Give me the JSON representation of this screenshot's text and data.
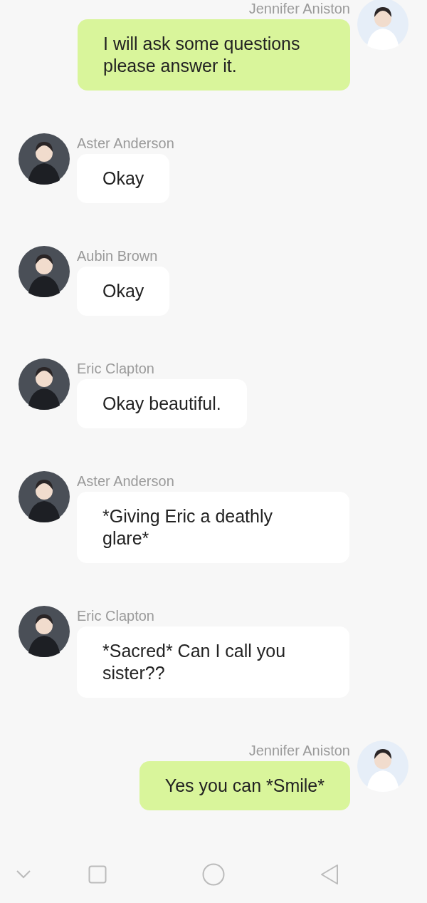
{
  "messages": [
    {
      "sender": "Jennifer Aniston",
      "kind": "sent",
      "text": "I will ask some questions please answer it."
    },
    {
      "sender": "Aster Anderson",
      "kind": "received",
      "text": "Okay"
    },
    {
      "sender": "Aubin Brown",
      "kind": "received",
      "text": "Okay"
    },
    {
      "sender": "Eric Clapton",
      "kind": "received",
      "text": "Okay beautiful."
    },
    {
      "sender": "Aster Anderson",
      "kind": "received",
      "text": "*Giving Eric a deathly glare*"
    },
    {
      "sender": "Eric Clapton",
      "kind": "received",
      "text": "*Sacred* Can I call you sister??"
    },
    {
      "sender": "Jennifer Aniston",
      "kind": "sent",
      "text": "Yes you can *Smile*"
    }
  ]
}
